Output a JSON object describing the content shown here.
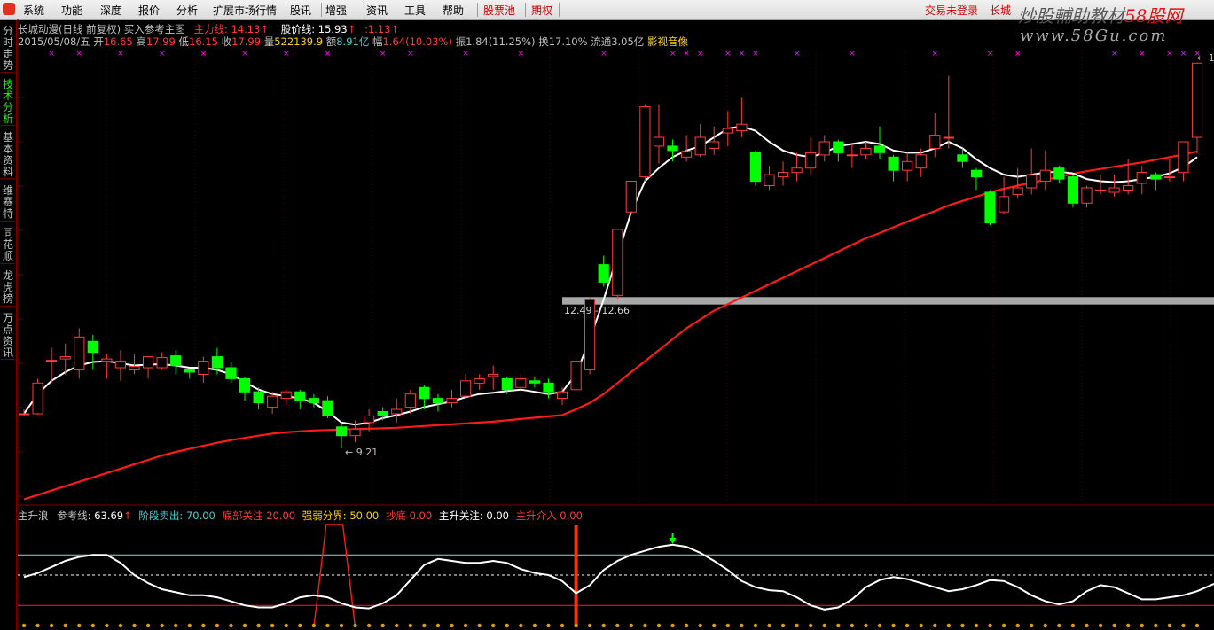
{
  "menubar": {
    "items": [
      "系统",
      "功能",
      "深度",
      "报价",
      "分析",
      "扩展市场行情",
      "股讯",
      "增强",
      "资讯",
      "工具",
      "帮助"
    ],
    "red_items": [
      "股票池",
      "期权"
    ],
    "login": "交易未登录",
    "right_name": "长城"
  },
  "watermark": {
    "main_left": "炒股輔助教材",
    "main_right": "58股网",
    "sub": "www.58Gu.com"
  },
  "sidebar": {
    "tabs": [
      {
        "label": "分时走势",
        "active": false
      },
      {
        "label": "技术分析",
        "active": true
      },
      {
        "label": "基本资料",
        "active": false
      },
      {
        "label": "维赛特",
        "active": false
      },
      {
        "label": "同花顺",
        "active": false
      },
      {
        "label": "龙虎榜",
        "active": false
      },
      {
        "label": "万点资讯",
        "active": false
      }
    ]
  },
  "main_header": {
    "title": "长城动漫(日线 前复权) 买入参考主图",
    "main_cost_label": "主力线",
    "main_cost_value": "14.13",
    "price_line_label": "股价线:",
    "price_line_value": "15.93",
    "diff_value": ":1.13"
  },
  "quote": {
    "date": "2015/05/08/五",
    "open_label": "开",
    "open": "16.65",
    "high_label": "高",
    "high": "17.99",
    "low_label": "低",
    "low": "16.15",
    "close_label": "收",
    "close": "17.99",
    "volume_label": "量",
    "volume": "522139.9",
    "amount_label": "额",
    "amount": "8.91亿",
    "change_label": "幅",
    "change": "1.64(10.03%)",
    "amplitude_label": "振",
    "amplitude": "1.84(11.25%)",
    "turnover_label": "换",
    "turnover": "17.10%",
    "float_label": "流通",
    "float": "3.05亿",
    "media": "影视音像"
  },
  "annotations": {
    "low_label": "9.21",
    "range_label": "12.49 - 12.66",
    "high_label": "1"
  },
  "indicator_header": {
    "name": "主升浪",
    "ref_label": "参考线:",
    "ref_value": "63.69",
    "sell_label": "阶段卖出:",
    "sell_value": "70.00",
    "bottom_label": "底部关注",
    "bottom_value": "20.00",
    "strength_label": "强弱分界:",
    "strength_value": "50.00",
    "dip_label": "抄底",
    "dip_value": "0.00",
    "rise_watch_label": "主升关注:",
    "rise_watch_value": "0.00",
    "rise_enter_label": "主升介入",
    "rise_enter_value": "0.00"
  },
  "colors": {
    "up": "#ff3b3b",
    "down": "#00ff00",
    "ma_white": "#ffffff",
    "ma_red": "#ff1a1a",
    "grid": "#7a0000",
    "cyan": "#40d0d0",
    "yellow": "#ffd000",
    "magenta": "#ff00ff"
  },
  "chart_data": {
    "type": "candlestick",
    "y_range": [
      8.0,
      18.3
    ],
    "candles": [
      [
        10.0,
        10.0,
        10.1,
        9.95
      ],
      [
        10.0,
        10.7,
        10.8,
        9.98
      ],
      [
        11.2,
        11.22,
        11.5,
        10.7
      ],
      [
        11.25,
        11.3,
        11.6,
        10.9
      ],
      [
        11.0,
        11.75,
        11.95,
        10.8
      ],
      [
        11.65,
        11.4,
        11.8,
        11.0
      ],
      [
        11.2,
        11.25,
        11.35,
        10.8
      ],
      [
        11.05,
        11.2,
        11.45,
        10.75
      ],
      [
        11.0,
        11.08,
        11.35,
        10.9
      ],
      [
        11.05,
        11.3,
        11.3,
        10.8
      ],
      [
        11.05,
        11.28,
        11.4,
        11.0
      ],
      [
        11.32,
        11.1,
        11.45,
        10.9
      ],
      [
        11.0,
        10.95,
        11.0,
        10.8
      ],
      [
        10.9,
        11.2,
        11.3,
        10.7
      ],
      [
        11.3,
        11.05,
        11.5,
        10.9
      ],
      [
        11.05,
        10.8,
        11.2,
        10.7
      ],
      [
        10.8,
        10.5,
        10.85,
        10.3
      ],
      [
        10.5,
        10.25,
        10.6,
        10.1
      ],
      [
        10.15,
        10.4,
        10.5,
        10.0
      ],
      [
        10.35,
        10.5,
        10.55,
        10.2
      ],
      [
        10.5,
        10.3,
        10.55,
        10.1
      ],
      [
        10.35,
        10.25,
        10.45,
        10.15
      ],
      [
        10.3,
        9.95,
        10.4,
        9.9
      ],
      [
        9.7,
        9.5,
        9.8,
        9.21
      ],
      [
        9.5,
        9.65,
        9.85,
        9.35
      ],
      [
        9.8,
        9.95,
        10.1,
        9.6
      ],
      [
        10.05,
        9.95,
        10.15,
        9.85
      ],
      [
        10.0,
        10.1,
        10.35,
        9.8
      ],
      [
        10.15,
        10.45,
        10.55,
        10.0
      ],
      [
        10.6,
        10.35,
        10.65,
        10.1
      ],
      [
        10.35,
        10.25,
        10.45,
        10.05
      ],
      [
        10.25,
        10.35,
        10.55,
        10.15
      ],
      [
        10.4,
        10.75,
        10.9,
        10.35
      ],
      [
        10.7,
        10.8,
        10.9,
        10.55
      ],
      [
        10.85,
        10.9,
        11.1,
        10.55
      ],
      [
        10.8,
        10.55,
        10.85,
        10.45
      ],
      [
        10.6,
        10.8,
        10.9,
        10.5
      ],
      [
        10.75,
        10.7,
        10.85,
        10.6
      ],
      [
        10.7,
        10.5,
        10.8,
        10.35
      ],
      [
        10.35,
        10.5,
        10.6,
        10.2
      ],
      [
        10.55,
        11.2,
        11.25,
        10.5
      ],
      [
        11.0,
        12.6,
        12.65,
        10.9
      ],
      [
        13.4,
        13.0,
        13.6,
        12.9
      ],
      [
        12.7,
        14.2,
        14.2,
        12.6
      ],
      [
        14.6,
        15.3,
        15.3,
        14.55
      ],
      [
        15.4,
        17.0,
        17.05,
        15.3
      ],
      [
        16.1,
        16.3,
        17.05,
        15.7
      ],
      [
        16.1,
        16.0,
        16.25,
        15.75
      ],
      [
        15.85,
        15.98,
        16.35,
        15.75
      ],
      [
        15.9,
        16.3,
        16.6,
        15.85
      ],
      [
        16.05,
        16.2,
        16.55,
        15.9
      ],
      [
        16.4,
        16.5,
        16.9,
        16.1
      ],
      [
        16.45,
        16.6,
        17.2,
        16.3
      ],
      [
        15.95,
        15.3,
        16.0,
        15.2
      ],
      [
        15.2,
        15.45,
        15.65,
        15.1
      ],
      [
        15.4,
        15.5,
        15.75,
        15.2
      ],
      [
        15.5,
        15.6,
        15.95,
        15.3
      ],
      [
        15.6,
        15.95,
        16.3,
        15.45
      ],
      [
        15.9,
        16.2,
        16.35,
        15.75
      ],
      [
        16.2,
        15.95,
        16.25,
        15.75
      ],
      [
        15.9,
        15.9,
        16.15,
        15.6
      ],
      [
        15.9,
        16.05,
        16.2,
        15.8
      ],
      [
        16.1,
        15.95,
        16.55,
        15.8
      ],
      [
        15.85,
        15.55,
        15.9,
        15.3
      ],
      [
        15.55,
        15.75,
        15.95,
        15.3
      ],
      [
        15.6,
        15.9,
        16.05,
        15.4
      ],
      [
        16.05,
        16.35,
        16.85,
        15.85
      ],
      [
        16.3,
        16.3,
        17.7,
        16.05
      ],
      [
        15.9,
        15.75,
        16.05,
        15.6
      ],
      [
        15.55,
        15.4,
        15.6,
        15.1
      ],
      [
        15.05,
        14.35,
        15.1,
        14.3
      ],
      [
        14.6,
        14.95,
        15.4,
        14.55
      ],
      [
        15.0,
        15.15,
        15.6,
        14.9
      ],
      [
        15.15,
        15.45,
        16.05,
        15.0
      ],
      [
        15.3,
        15.55,
        16.0,
        15.1
      ],
      [
        15.6,
        15.35,
        15.65,
        15.25
      ],
      [
        15.4,
        14.8,
        15.45,
        14.7
      ],
      [
        14.8,
        15.15,
        15.2,
        14.7
      ],
      [
        15.1,
        15.1,
        15.45,
        15.0
      ],
      [
        15.05,
        15.15,
        15.45,
        14.95
      ],
      [
        15.1,
        15.2,
        15.8,
        15.0
      ],
      [
        15.25,
        15.5,
        15.65,
        15.0
      ],
      [
        15.45,
        15.35,
        15.5,
        15.1
      ],
      [
        15.4,
        15.4,
        15.8,
        15.3
      ],
      [
        15.5,
        16.2,
        16.2,
        15.3
      ],
      [
        16.3,
        17.99,
        17.99,
        15.93
      ]
    ],
    "ma_white": [
      10.0,
      10.45,
      10.75,
      10.95,
      11.1,
      11.18,
      11.2,
      11.15,
      11.1,
      11.12,
      11.13,
      11.1,
      11.05,
      11.05,
      11.0,
      10.9,
      10.72,
      10.55,
      10.45,
      10.4,
      10.35,
      10.25,
      10.05,
      9.8,
      9.75,
      9.8,
      9.9,
      9.97,
      10.05,
      10.15,
      10.22,
      10.28,
      10.38,
      10.45,
      10.48,
      10.52,
      10.55,
      10.5,
      10.45,
      10.5,
      10.9,
      11.7,
      12.6,
      13.6,
      14.6,
      15.3,
      15.6,
      15.85,
      16.0,
      16.1,
      16.3,
      16.5,
      16.55,
      16.45,
      16.2,
      16.0,
      15.9,
      15.85,
      15.95,
      16.1,
      16.15,
      16.2,
      16.15,
      16.0,
      15.95,
      15.95,
      16.05,
      16.2,
      16.05,
      15.8,
      15.6,
      15.45,
      15.4,
      15.45,
      15.5,
      15.52,
      15.48,
      15.35,
      15.3,
      15.28,
      15.3,
      15.35,
      15.4,
      15.48,
      15.62,
      15.85
    ],
    "ma_red": [
      8.05,
      8.15,
      8.25,
      8.35,
      8.45,
      8.55,
      8.65,
      8.75,
      8.85,
      8.95,
      9.05,
      9.13,
      9.2,
      9.27,
      9.34,
      9.4,
      9.45,
      9.5,
      9.55,
      9.58,
      9.6,
      9.62,
      9.63,
      9.64,
      9.65,
      9.66,
      9.67,
      9.68,
      9.7,
      9.72,
      9.74,
      9.76,
      9.78,
      9.8,
      9.82,
      9.85,
      9.88,
      9.91,
      9.94,
      9.97,
      10.1,
      10.25,
      10.45,
      10.7,
      10.95,
      11.2,
      11.45,
      11.7,
      11.95,
      12.15,
      12.35,
      12.5,
      12.65,
      12.8,
      12.95,
      13.1,
      13.25,
      13.4,
      13.55,
      13.7,
      13.85,
      14.0,
      14.12,
      14.25,
      14.38,
      14.5,
      14.62,
      14.75,
      14.85,
      14.95,
      15.05,
      15.13,
      15.2,
      15.27,
      15.33,
      15.4,
      15.47,
      15.53,
      15.58,
      15.63,
      15.68,
      15.73,
      15.79,
      15.85,
      15.91,
      15.98
    ],
    "band": [
      12.49,
      12.66
    ],
    "marker_candles": [
      2,
      4,
      7,
      10,
      13,
      16,
      19,
      22,
      26,
      28,
      32,
      36,
      42,
      47,
      48,
      49,
      51,
      52,
      53,
      56,
      60,
      66,
      70,
      72,
      79,
      81,
      83,
      84,
      85
    ],
    "oscillator": {
      "y_range": [
        0,
        100
      ],
      "levels": {
        "sell": 70.0,
        "strength": 50.0,
        "bottom": 20.0
      },
      "values": [
        48,
        52,
        58,
        64,
        68,
        70,
        70,
        62,
        50,
        42,
        36,
        33,
        30,
        30,
        28,
        24,
        20,
        18,
        18,
        22,
        28,
        30,
        28,
        22,
        18,
        17,
        22,
        30,
        45,
        60,
        66,
        64,
        62,
        62,
        64,
        62,
        56,
        52,
        50,
        44,
        32,
        40,
        55,
        64,
        70,
        74,
        78,
        80,
        78,
        72,
        64,
        55,
        44,
        38,
        35,
        34,
        28,
        20,
        16,
        18,
        26,
        38,
        45,
        48,
        46,
        42,
        38,
        34,
        36,
        40,
        45,
        44,
        38,
        30,
        24,
        21,
        24,
        34,
        40,
        38,
        32,
        26,
        26,
        28,
        30,
        34,
        40,
        46
      ]
    },
    "osc_spike_candle": 40,
    "osc_arrow_candle": 47,
    "osc_hump_range": [
      21,
      24
    ]
  }
}
